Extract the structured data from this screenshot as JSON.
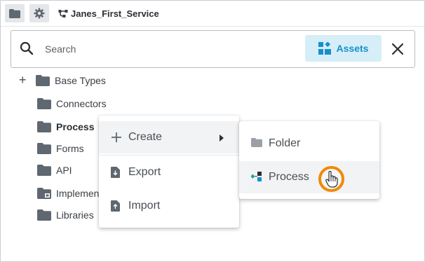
{
  "topbar": {
    "service_name": "Janes_First_Service",
    "icons": [
      "folder-icon",
      "gear-icon",
      "service-icon"
    ]
  },
  "search": {
    "placeholder": "Search",
    "assets_label": "Assets"
  },
  "tree": {
    "items": [
      {
        "label": "Base Types",
        "expandable": true
      },
      {
        "label": "Connectors"
      },
      {
        "label": "Process",
        "bold": true
      },
      {
        "label": "Forms"
      },
      {
        "label": "API"
      },
      {
        "label": "Implementation"
      },
      {
        "label": "Libraries"
      }
    ]
  },
  "context_menu": {
    "items": [
      {
        "label": "Create",
        "icon": "plus-icon",
        "has_submenu": true
      },
      {
        "label": "Export",
        "icon": "export-file-icon"
      },
      {
        "label": "Import",
        "icon": "import-file-icon"
      }
    ]
  },
  "submenu": {
    "items": [
      {
        "label": "Folder",
        "icon": "folder-icon"
      },
      {
        "label": "Process",
        "icon": "process-icon",
        "hovered": true
      }
    ]
  },
  "colors": {
    "accent": "#1690cc",
    "assets_bg": "#d6eef8",
    "folder": "#5f6770",
    "cursor_ring": "#f08a00"
  }
}
